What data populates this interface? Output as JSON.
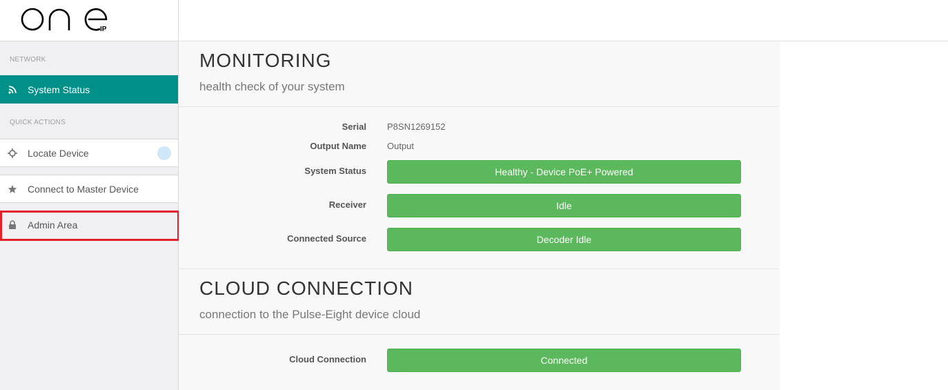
{
  "brand": {
    "logo_text": "one",
    "logo_sub": "IP"
  },
  "sidebar": {
    "network_label": "NETWORK",
    "quick_actions_label": "QUICK ACTIONS",
    "system_status": "System Status",
    "locate_device": "Locate Device",
    "connect_master": "Connect to Master Device",
    "admin_area": "Admin Area"
  },
  "monitoring": {
    "title": "MONITORING",
    "subtitle": "health check of your system",
    "serial_label": "Serial",
    "serial_value": "P8SN1269152",
    "output_name_label": "Output Name",
    "output_name_value": "Output",
    "system_status_label": "System Status",
    "system_status_value": "Healthy - Device PoE+ Powered",
    "receiver_label": "Receiver",
    "receiver_value": "Idle",
    "connected_source_label": "Connected Source",
    "connected_source_value": "Decoder Idle"
  },
  "cloud": {
    "title": "CLOUD CONNECTION",
    "subtitle": "connection to the Pulse-Eight device cloud",
    "connection_label": "Cloud Connection",
    "connection_value": "Connected"
  },
  "colors": {
    "accent": "#00908a",
    "success": "#5cb85c",
    "highlight": "#e3202a"
  }
}
